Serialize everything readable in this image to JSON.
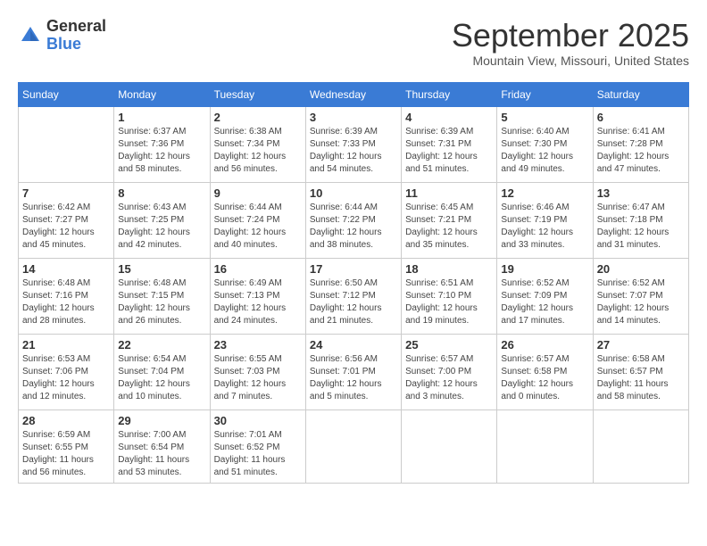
{
  "logo": {
    "general": "General",
    "blue": "Blue"
  },
  "title": "September 2025",
  "location": "Mountain View, Missouri, United States",
  "weekdays": [
    "Sunday",
    "Monday",
    "Tuesday",
    "Wednesday",
    "Thursday",
    "Friday",
    "Saturday"
  ],
  "weeks": [
    [
      {
        "day": "",
        "sunrise": "",
        "sunset": "",
        "daylight": ""
      },
      {
        "day": "1",
        "sunrise": "Sunrise: 6:37 AM",
        "sunset": "Sunset: 7:36 PM",
        "daylight": "Daylight: 12 hours and 58 minutes."
      },
      {
        "day": "2",
        "sunrise": "Sunrise: 6:38 AM",
        "sunset": "Sunset: 7:34 PM",
        "daylight": "Daylight: 12 hours and 56 minutes."
      },
      {
        "day": "3",
        "sunrise": "Sunrise: 6:39 AM",
        "sunset": "Sunset: 7:33 PM",
        "daylight": "Daylight: 12 hours and 54 minutes."
      },
      {
        "day": "4",
        "sunrise": "Sunrise: 6:39 AM",
        "sunset": "Sunset: 7:31 PM",
        "daylight": "Daylight: 12 hours and 51 minutes."
      },
      {
        "day": "5",
        "sunrise": "Sunrise: 6:40 AM",
        "sunset": "Sunset: 7:30 PM",
        "daylight": "Daylight: 12 hours and 49 minutes."
      },
      {
        "day": "6",
        "sunrise": "Sunrise: 6:41 AM",
        "sunset": "Sunset: 7:28 PM",
        "daylight": "Daylight: 12 hours and 47 minutes."
      }
    ],
    [
      {
        "day": "7",
        "sunrise": "Sunrise: 6:42 AM",
        "sunset": "Sunset: 7:27 PM",
        "daylight": "Daylight: 12 hours and 45 minutes."
      },
      {
        "day": "8",
        "sunrise": "Sunrise: 6:43 AM",
        "sunset": "Sunset: 7:25 PM",
        "daylight": "Daylight: 12 hours and 42 minutes."
      },
      {
        "day": "9",
        "sunrise": "Sunrise: 6:44 AM",
        "sunset": "Sunset: 7:24 PM",
        "daylight": "Daylight: 12 hours and 40 minutes."
      },
      {
        "day": "10",
        "sunrise": "Sunrise: 6:44 AM",
        "sunset": "Sunset: 7:22 PM",
        "daylight": "Daylight: 12 hours and 38 minutes."
      },
      {
        "day": "11",
        "sunrise": "Sunrise: 6:45 AM",
        "sunset": "Sunset: 7:21 PM",
        "daylight": "Daylight: 12 hours and 35 minutes."
      },
      {
        "day": "12",
        "sunrise": "Sunrise: 6:46 AM",
        "sunset": "Sunset: 7:19 PM",
        "daylight": "Daylight: 12 hours and 33 minutes."
      },
      {
        "day": "13",
        "sunrise": "Sunrise: 6:47 AM",
        "sunset": "Sunset: 7:18 PM",
        "daylight": "Daylight: 12 hours and 31 minutes."
      }
    ],
    [
      {
        "day": "14",
        "sunrise": "Sunrise: 6:48 AM",
        "sunset": "Sunset: 7:16 PM",
        "daylight": "Daylight: 12 hours and 28 minutes."
      },
      {
        "day": "15",
        "sunrise": "Sunrise: 6:48 AM",
        "sunset": "Sunset: 7:15 PM",
        "daylight": "Daylight: 12 hours and 26 minutes."
      },
      {
        "day": "16",
        "sunrise": "Sunrise: 6:49 AM",
        "sunset": "Sunset: 7:13 PM",
        "daylight": "Daylight: 12 hours and 24 minutes."
      },
      {
        "day": "17",
        "sunrise": "Sunrise: 6:50 AM",
        "sunset": "Sunset: 7:12 PM",
        "daylight": "Daylight: 12 hours and 21 minutes."
      },
      {
        "day": "18",
        "sunrise": "Sunrise: 6:51 AM",
        "sunset": "Sunset: 7:10 PM",
        "daylight": "Daylight: 12 hours and 19 minutes."
      },
      {
        "day": "19",
        "sunrise": "Sunrise: 6:52 AM",
        "sunset": "Sunset: 7:09 PM",
        "daylight": "Daylight: 12 hours and 17 minutes."
      },
      {
        "day": "20",
        "sunrise": "Sunrise: 6:52 AM",
        "sunset": "Sunset: 7:07 PM",
        "daylight": "Daylight: 12 hours and 14 minutes."
      }
    ],
    [
      {
        "day": "21",
        "sunrise": "Sunrise: 6:53 AM",
        "sunset": "Sunset: 7:06 PM",
        "daylight": "Daylight: 12 hours and 12 minutes."
      },
      {
        "day": "22",
        "sunrise": "Sunrise: 6:54 AM",
        "sunset": "Sunset: 7:04 PM",
        "daylight": "Daylight: 12 hours and 10 minutes."
      },
      {
        "day": "23",
        "sunrise": "Sunrise: 6:55 AM",
        "sunset": "Sunset: 7:03 PM",
        "daylight": "Daylight: 12 hours and 7 minutes."
      },
      {
        "day": "24",
        "sunrise": "Sunrise: 6:56 AM",
        "sunset": "Sunset: 7:01 PM",
        "daylight": "Daylight: 12 hours and 5 minutes."
      },
      {
        "day": "25",
        "sunrise": "Sunrise: 6:57 AM",
        "sunset": "Sunset: 7:00 PM",
        "daylight": "Daylight: 12 hours and 3 minutes."
      },
      {
        "day": "26",
        "sunrise": "Sunrise: 6:57 AM",
        "sunset": "Sunset: 6:58 PM",
        "daylight": "Daylight: 12 hours and 0 minutes."
      },
      {
        "day": "27",
        "sunrise": "Sunrise: 6:58 AM",
        "sunset": "Sunset: 6:57 PM",
        "daylight": "Daylight: 11 hours and 58 minutes."
      }
    ],
    [
      {
        "day": "28",
        "sunrise": "Sunrise: 6:59 AM",
        "sunset": "Sunset: 6:55 PM",
        "daylight": "Daylight: 11 hours and 56 minutes."
      },
      {
        "day": "29",
        "sunrise": "Sunrise: 7:00 AM",
        "sunset": "Sunset: 6:54 PM",
        "daylight": "Daylight: 11 hours and 53 minutes."
      },
      {
        "day": "30",
        "sunrise": "Sunrise: 7:01 AM",
        "sunset": "Sunset: 6:52 PM",
        "daylight": "Daylight: 11 hours and 51 minutes."
      },
      {
        "day": "",
        "sunrise": "",
        "sunset": "",
        "daylight": ""
      },
      {
        "day": "",
        "sunrise": "",
        "sunset": "",
        "daylight": ""
      },
      {
        "day": "",
        "sunrise": "",
        "sunset": "",
        "daylight": ""
      },
      {
        "day": "",
        "sunrise": "",
        "sunset": "",
        "daylight": ""
      }
    ]
  ]
}
